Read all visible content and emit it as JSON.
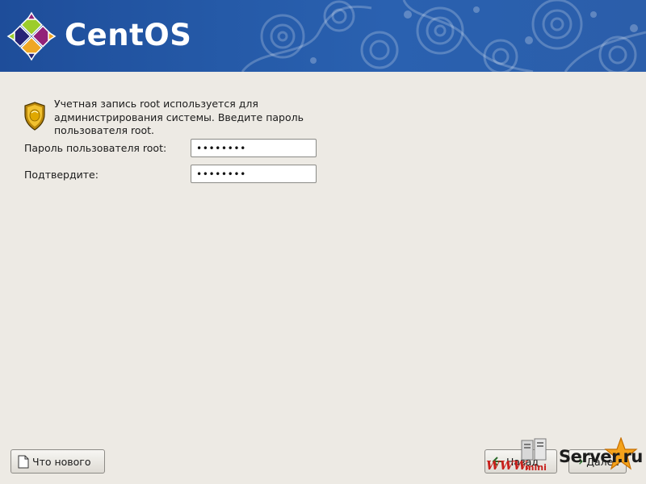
{
  "banner": {
    "logo_text": "CentOS"
  },
  "root_password": {
    "info_text": "Учетная запись root используется для\nадминистрирования системы. Введите пароль\nпользователя root.",
    "password_label": "Пароль пользователя root:",
    "password_value": "••••••••",
    "confirm_label": "Подтвердите:",
    "confirm_value": "••••••••"
  },
  "buttons": {
    "release_notes": "Что нового",
    "back": "Назад",
    "next": "Далее"
  },
  "watermark": {
    "www": "WWW.",
    "mini": "mini",
    "server": "Server.ru"
  },
  "colors": {
    "banner": "#255aa8",
    "background": "#edeae4",
    "watermark_red": "#c8201c"
  },
  "icons": {
    "logo": "centos-logo-icon",
    "info": "shield-icon",
    "release_notes": "document-icon",
    "back": "arrow-left-icon",
    "next": "arrow-right-icon"
  }
}
